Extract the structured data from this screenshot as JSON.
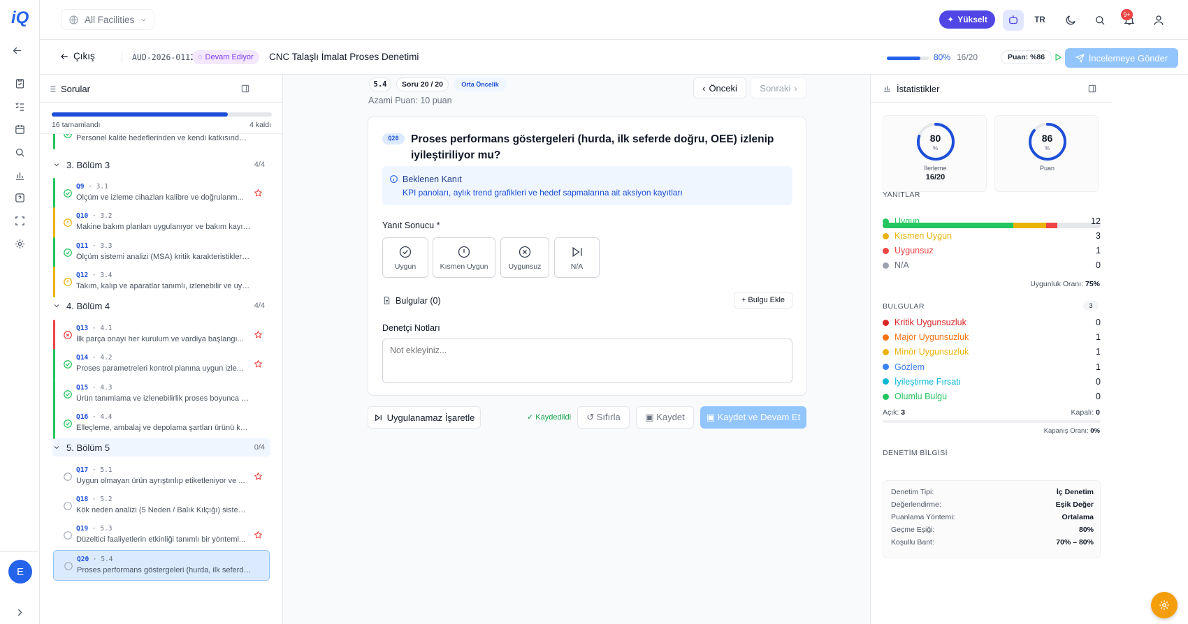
{
  "header": {
    "facility": "All Facilities",
    "upgrade_label": "Yükselt",
    "lang": "TR",
    "notif_count": "9+",
    "avatar_initial": "E"
  },
  "audit": {
    "exit_label": "Çıkış",
    "id": "AUD-2026-0112",
    "status": "Devam Ediyor",
    "title": "CNC Talaşlı İmalat Proses Denetimi",
    "progress_fraction": 0.8,
    "progress_pct": "80%",
    "progress_count": "16/20",
    "score_label": "Puan: %86",
    "send_label": "İncelemeye Gönder"
  },
  "questions_panel": {
    "title": "Sorular",
    "completed_fraction": 0.8,
    "completed_label": "16 tamamlandı",
    "left_label": "4 kaldı",
    "partial_item_text": "Personel kalite hedeflerinden ve kendi katkısından ...",
    "sections": [
      {
        "name": "3. Bölüm 3",
        "count": "4/4"
      },
      {
        "name": "4. Bölüm 4",
        "count": "4/4"
      },
      {
        "name": "5. Bölüm 5",
        "count": "0/4"
      }
    ],
    "items": [
      {
        "code": "Q9",
        "ref": "3.1",
        "text": "Ölçüm ve izleme cihazları kalibre ve doğrulanm...",
        "status": "ok",
        "star": true
      },
      {
        "code": "Q10",
        "ref": "3.2",
        "text": "Makine bakım planları uygulanıyor ve bakım kayıtla...",
        "status": "partial",
        "star": false
      },
      {
        "code": "Q11",
        "ref": "3.3",
        "text": "Ölçüm sistemi analizi (MSA) kritik karakteristikler i...",
        "status": "ok",
        "star": false
      },
      {
        "code": "Q12",
        "ref": "3.4",
        "text": "Takım, kalıp ve aparatlar tanımlı, izlenebilir ve uygu...",
        "status": "partial",
        "star": false
      },
      {
        "code": "Q13",
        "ref": "4.1",
        "text": "İlk parça onayı her kurulum ve vardiya başlangı...",
        "status": "fail",
        "star": true
      },
      {
        "code": "Q14",
        "ref": "4.2",
        "text": "Proses parametreleri kontrol planına uygun izle...",
        "status": "ok",
        "star": true
      },
      {
        "code": "Q15",
        "ref": "4.3",
        "text": "Ürün tanımlama ve izlenebilirlik proses boyunca ko...",
        "status": "ok",
        "star": false
      },
      {
        "code": "Q16",
        "ref": "4.4",
        "text": "Elleçleme, ambalaj ve depolama şartları ürünü koru...",
        "status": "ok",
        "star": false
      },
      {
        "code": "Q17",
        "ref": "5.1",
        "text": "Uygun olmayan ürün ayrıştırılıp etiketleniyor ve ...",
        "status": "none",
        "star": true
      },
      {
        "code": "Q18",
        "ref": "5.2",
        "text": "Kök neden analizi (5 Neden / Balık Kılçığı) sistemati...",
        "status": "none",
        "star": false
      },
      {
        "code": "Q19",
        "ref": "5.3",
        "text": "Düzeltici faaliyetlerin etkinliği tanımlı bir yönteml...",
        "status": "none",
        "star": true
      },
      {
        "code": "Q20",
        "ref": "5.4",
        "text": "Proses performans göstergeleri (hurda, ilk seferde ...",
        "status": "none",
        "star": false
      }
    ]
  },
  "question": {
    "ref": "5.4",
    "position": "Soru 20 / 20",
    "priority": "Orta Öncelik",
    "max_points": "Azami Puan: 10 puan",
    "prev_label": "Önceki",
    "next_label": "Sonraki",
    "code": "Q20",
    "text": "Proses performans göstergeleri (hurda, ilk seferde doğru, OEE) izlenip iyileştiriliyor mu?",
    "evidence_title": "Beklenen Kanıt",
    "evidence_text": "KPI panoları, aylık trend grafikleri ve hedef sapmalarına ait aksiyon kayıtları",
    "answer_label": "Yanıt Sonucu *",
    "answers": [
      "Uygun",
      "Kısmen Uygun",
      "Uygunsuz",
      "N/A"
    ],
    "findings_label": "Bulgular (0)",
    "add_finding_label": "+ Bulgu Ekle",
    "notes_label": "Denetçi Notları",
    "notes_placeholder": "Not ekleyiniz...",
    "na_label": "Uygulanamaz İşaretle",
    "saved_label": "✓ Kaydedildi",
    "reset_label": "Sıfırla",
    "save_label": "Kaydet",
    "save_continue_label": "Kaydet ve Devam Et"
  },
  "stats": {
    "title": "İstatistikler",
    "progress_ring": {
      "value": "80",
      "unit": "%",
      "label": "İlerleme",
      "sub": "16/20",
      "fraction": 0.8
    },
    "score_ring": {
      "value": "86",
      "unit": "%",
      "label": "Puan",
      "fraction": 0.86
    },
    "answers_title": "YANITLAR",
    "answers": [
      {
        "label": "Uygun",
        "value": "12",
        "color": "#22c55e"
      },
      {
        "label": "Kısmen Uygun",
        "value": "3",
        "color": "#eab308"
      },
      {
        "label": "Uygunsuz",
        "value": "1",
        "color": "#ef4444"
      },
      {
        "label": "N/A",
        "value": "0",
        "color": "#9ca3af"
      }
    ],
    "compliance_label": "Uygunluk Oranı:",
    "compliance_value": "75%",
    "findings_title": "BULGULAR",
    "findings_count": "3",
    "findings": [
      {
        "label": "Kritik Uygunsuzluk",
        "value": "0",
        "color": "#dc2626"
      },
      {
        "label": "Majör Uygunsuzluk",
        "value": "1",
        "color": "#f97316"
      },
      {
        "label": "Minör Uygunsuzluk",
        "value": "1",
        "color": "#eab308"
      },
      {
        "label": "Gözlem",
        "value": "1",
        "color": "#3b82f6"
      },
      {
        "label": "İyileştirme Fırsatı",
        "value": "0",
        "color": "#06b6d4"
      },
      {
        "label": "Olumlu Bulgu",
        "value": "0",
        "color": "#22c55e"
      }
    ],
    "open_label": "Açık:",
    "open_value": "3",
    "closed_label": "Kapalı:",
    "closed_value": "0",
    "closure_label": "Kapanış Oranı:",
    "closure_value": "0%",
    "info_title": "DENETİM BİLGİSİ",
    "info": [
      {
        "k": "Denetim Tipi:",
        "v": "İç Denetim"
      },
      {
        "k": "Değerlendirme:",
        "v": "Eşik Değer"
      },
      {
        "k": "Puanlama Yöntemi:",
        "v": "Ortalama"
      },
      {
        "k": "Geçme Eşiği:",
        "v": "80%"
      },
      {
        "k": "Koşullu Bant:",
        "v": "70% – 80%"
      }
    ]
  }
}
